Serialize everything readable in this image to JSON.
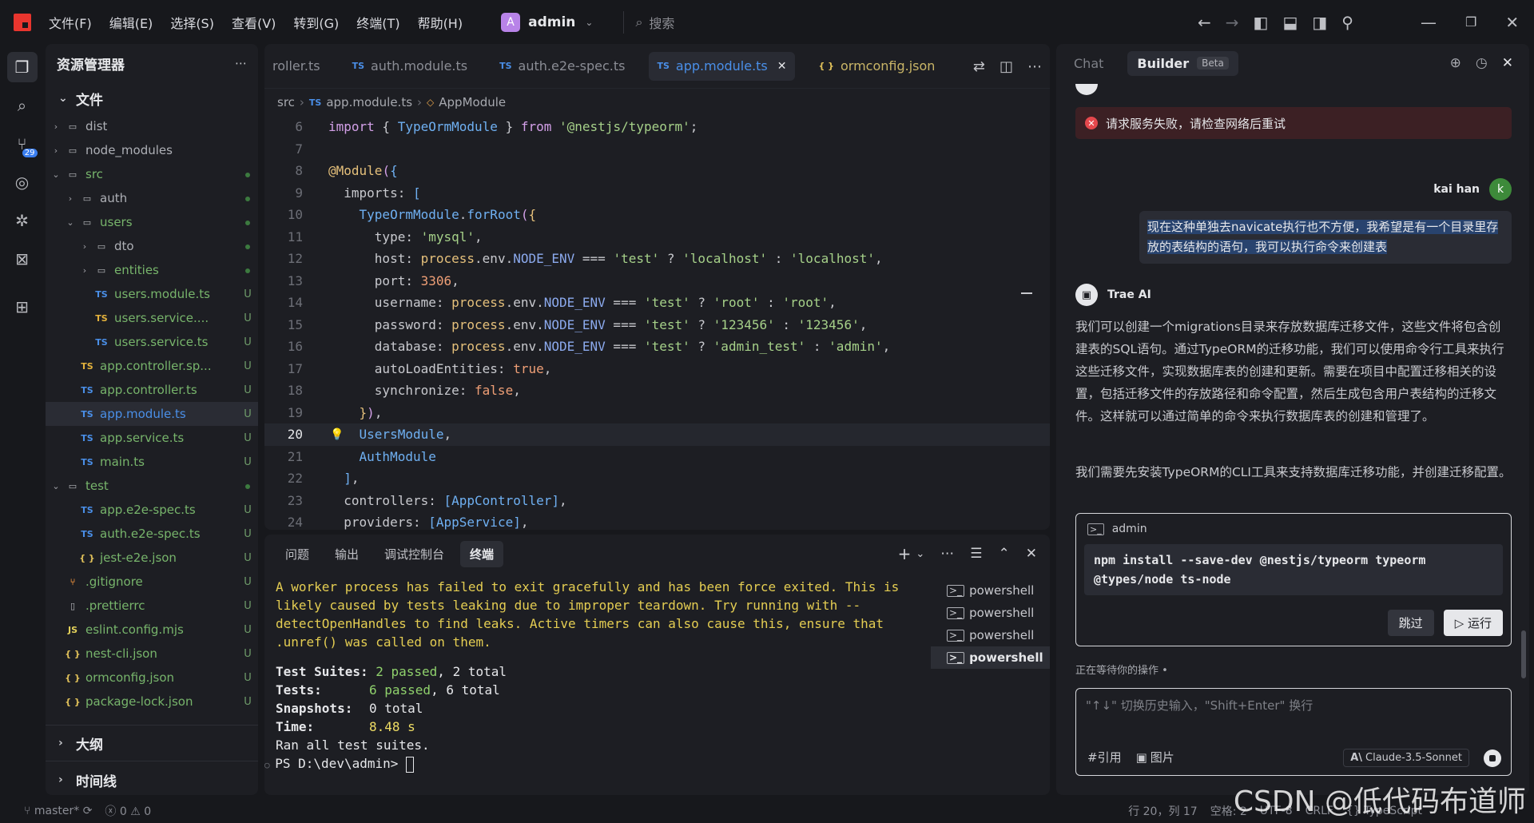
{
  "titlebar": {
    "menu": [
      "文件(F)",
      "编辑(E)",
      "选择(S)",
      "查看(V)",
      "转到(G)",
      "终端(T)",
      "帮助(H)"
    ],
    "workspace_initial": "A",
    "workspace_name": "admin",
    "search_placeholder": "搜索"
  },
  "explorer": {
    "title": "资源管理器",
    "section_files": "文件",
    "items": [
      {
        "name": "dist",
        "kind": "folder",
        "depth": 0,
        "expanded": false,
        "status": ""
      },
      {
        "name": "node_modules",
        "kind": "folder",
        "depth": 0,
        "expanded": false,
        "status": ""
      },
      {
        "name": "src",
        "kind": "folder",
        "depth": 0,
        "expanded": true,
        "status": "dot",
        "color": "green"
      },
      {
        "name": "auth",
        "kind": "folder",
        "depth": 1,
        "expanded": false,
        "status": "dot"
      },
      {
        "name": "users",
        "kind": "folder",
        "depth": 1,
        "expanded": true,
        "status": "dot",
        "color": "green"
      },
      {
        "name": "dto",
        "kind": "folder",
        "depth": 2,
        "expanded": false,
        "status": "dot"
      },
      {
        "name": "entities",
        "kind": "folder",
        "depth": 2,
        "expanded": false,
        "status": "dot",
        "color": "green"
      },
      {
        "name": "users.module.ts",
        "kind": "ts",
        "depth": 2,
        "status": "U",
        "color": "green"
      },
      {
        "name": "users.service....",
        "kind": "ts-yellow",
        "depth": 2,
        "status": "U",
        "color": "green"
      },
      {
        "name": "users.service.ts",
        "kind": "ts",
        "depth": 2,
        "status": "U",
        "color": "green"
      },
      {
        "name": "app.controller.sp...",
        "kind": "ts-yellow",
        "depth": 1,
        "status": "U",
        "color": "green"
      },
      {
        "name": "app.controller.ts",
        "kind": "ts",
        "depth": 1,
        "status": "U",
        "color": "green"
      },
      {
        "name": "app.module.ts",
        "kind": "ts",
        "depth": 1,
        "status": "U",
        "color": "blue",
        "selected": true
      },
      {
        "name": "app.service.ts",
        "kind": "ts",
        "depth": 1,
        "status": "U",
        "color": "green"
      },
      {
        "name": "main.ts",
        "kind": "ts",
        "depth": 1,
        "status": "U",
        "color": "green"
      },
      {
        "name": "test",
        "kind": "folder",
        "depth": 0,
        "expanded": true,
        "status": "dot",
        "color": "green"
      },
      {
        "name": "app.e2e-spec.ts",
        "kind": "ts",
        "depth": 1,
        "status": "U",
        "color": "green"
      },
      {
        "name": "auth.e2e-spec.ts",
        "kind": "ts",
        "depth": 1,
        "status": "U",
        "color": "green"
      },
      {
        "name": "jest-e2e.json",
        "kind": "json",
        "depth": 1,
        "status": "U",
        "color": "green"
      },
      {
        "name": ".gitignore",
        "kind": "git",
        "depth": 0,
        "status": "U",
        "color": "green"
      },
      {
        "name": ".prettierrc",
        "kind": "file",
        "depth": 0,
        "status": "U",
        "color": "green"
      },
      {
        "name": "eslint.config.mjs",
        "kind": "js",
        "depth": 0,
        "status": "U",
        "color": "green"
      },
      {
        "name": "nest-cli.json",
        "kind": "json",
        "depth": 0,
        "status": "U",
        "color": "green"
      },
      {
        "name": "ormconfig.json",
        "kind": "json",
        "depth": 0,
        "status": "U",
        "color": "green"
      },
      {
        "name": "package-lock.json",
        "kind": "json",
        "depth": 0,
        "status": "U",
        "color": "green"
      }
    ],
    "section_outline": "大纲",
    "section_timeline": "时间线"
  },
  "editor": {
    "tabs": [
      {
        "label": "roller.ts",
        "icon": "",
        "active": false
      },
      {
        "label": "auth.module.ts",
        "icon": "TS",
        "active": false
      },
      {
        "label": "auth.e2e-spec.ts",
        "icon": "TS",
        "active": false
      },
      {
        "label": "app.module.ts",
        "icon": "TS",
        "active": true
      },
      {
        "label": "ormconfig.json",
        "icon": "{ }",
        "active": false
      }
    ],
    "breadcrumb": {
      "folder": "src",
      "file_icon": "TS",
      "file": "app.module.ts",
      "symbol": "AppModule"
    },
    "current_line": 20,
    "lines": [
      {
        "n": 6,
        "tokens": [
          [
            "kw",
            "import"
          ],
          [
            "p",
            " { "
          ],
          [
            "fn",
            "TypeOrmModule"
          ],
          [
            "p",
            " } "
          ],
          [
            "kw",
            "from"
          ],
          [
            "p",
            " "
          ],
          [
            "str",
            "'@nestjs/typeorm'"
          ],
          [
            "p",
            ";"
          ]
        ]
      },
      {
        "n": 7,
        "tokens": []
      },
      {
        "n": 8,
        "tokens": [
          [
            "dec",
            "@Module"
          ],
          [
            "brk",
            "("
          ],
          [
            "brk2",
            "{"
          ]
        ]
      },
      {
        "n": 9,
        "tokens": [
          [
            "p",
            "  imports: "
          ],
          [
            "brk2",
            "["
          ]
        ]
      },
      {
        "n": 10,
        "tokens": [
          [
            "p",
            "    "
          ],
          [
            "fn",
            "TypeOrmModule"
          ],
          [
            "p",
            "."
          ],
          [
            "fn",
            "forRoot"
          ],
          [
            "brk",
            "("
          ],
          [
            "dec",
            "{"
          ]
        ]
      },
      {
        "n": 11,
        "tokens": [
          [
            "p",
            "      type: "
          ],
          [
            "str",
            "'mysql'"
          ],
          [
            "p",
            ","
          ]
        ]
      },
      {
        "n": 12,
        "tokens": [
          [
            "p",
            "      host: "
          ],
          [
            "dec",
            "process"
          ],
          [
            "p",
            "."
          ],
          [
            "p",
            "env"
          ],
          [
            "p",
            "."
          ],
          [
            "var",
            "NODE_ENV"
          ],
          [
            "p",
            " === "
          ],
          [
            "str",
            "'test'"
          ],
          [
            "p",
            " ? "
          ],
          [
            "str",
            "'localhost'"
          ],
          [
            "p",
            " : "
          ],
          [
            "str",
            "'localhost'"
          ],
          [
            "p",
            ","
          ]
        ]
      },
      {
        "n": 13,
        "tokens": [
          [
            "p",
            "      port: "
          ],
          [
            "num",
            "3306"
          ],
          [
            "p",
            ","
          ]
        ]
      },
      {
        "n": 14,
        "tokens": [
          [
            "p",
            "      username: "
          ],
          [
            "dec",
            "process"
          ],
          [
            "p",
            ".env."
          ],
          [
            "var",
            "NODE_ENV"
          ],
          [
            "p",
            " === "
          ],
          [
            "str",
            "'test'"
          ],
          [
            "p",
            " ? "
          ],
          [
            "str",
            "'root'"
          ],
          [
            "p",
            " : "
          ],
          [
            "str",
            "'root'"
          ],
          [
            "p",
            ","
          ]
        ]
      },
      {
        "n": 15,
        "tokens": [
          [
            "p",
            "      password: "
          ],
          [
            "dec",
            "process"
          ],
          [
            "p",
            ".env."
          ],
          [
            "var",
            "NODE_ENV"
          ],
          [
            "p",
            " === "
          ],
          [
            "str",
            "'test'"
          ],
          [
            "p",
            " ? "
          ],
          [
            "str",
            "'123456'"
          ],
          [
            "p",
            " : "
          ],
          [
            "str",
            "'123456'"
          ],
          [
            "p",
            ","
          ]
        ]
      },
      {
        "n": 16,
        "tokens": [
          [
            "p",
            "      database: "
          ],
          [
            "dec",
            "process"
          ],
          [
            "p",
            ".env."
          ],
          [
            "var",
            "NODE_ENV"
          ],
          [
            "p",
            " === "
          ],
          [
            "str",
            "'test'"
          ],
          [
            "p",
            " ? "
          ],
          [
            "str",
            "'admin_test'"
          ],
          [
            "p",
            " : "
          ],
          [
            "str",
            "'admin'"
          ],
          [
            "p",
            ","
          ]
        ]
      },
      {
        "n": 17,
        "tokens": [
          [
            "p",
            "      autoLoadEntities: "
          ],
          [
            "bool",
            "true"
          ],
          [
            "p",
            ","
          ]
        ]
      },
      {
        "n": 18,
        "tokens": [
          [
            "p",
            "      synchronize: "
          ],
          [
            "bool",
            "false"
          ],
          [
            "p",
            ","
          ]
        ]
      },
      {
        "n": 19,
        "tokens": [
          [
            "p",
            "    "
          ],
          [
            "dec",
            "}"
          ],
          [
            "brk",
            ")"
          ],
          [
            "p",
            ","
          ]
        ]
      },
      {
        "n": 20,
        "tokens": [
          [
            "p",
            "    "
          ],
          [
            "fn",
            "UsersModule"
          ],
          [
            "p",
            ","
          ]
        ]
      },
      {
        "n": 21,
        "tokens": [
          [
            "p",
            "    "
          ],
          [
            "fn",
            "AuthModule"
          ]
        ]
      },
      {
        "n": 22,
        "tokens": [
          [
            "p",
            "  "
          ],
          [
            "brk2",
            "]"
          ],
          [
            "p",
            ","
          ]
        ]
      },
      {
        "n": 23,
        "tokens": [
          [
            "p",
            "  controllers: "
          ],
          [
            "brk2",
            "["
          ],
          [
            "fn",
            "AppController"
          ],
          [
            "brk2",
            "]"
          ],
          [
            "p",
            ","
          ]
        ]
      },
      {
        "n": 24,
        "tokens": [
          [
            "p",
            "  providers: "
          ],
          [
            "brk2",
            "["
          ],
          [
            "fn",
            "AppService"
          ],
          [
            "brk2",
            "]"
          ],
          [
            "p",
            ","
          ]
        ]
      }
    ]
  },
  "panel": {
    "tabs": [
      "问题",
      "输出",
      "调试控制台",
      "终端"
    ],
    "active_tab": "终端",
    "terminal": {
      "warning": "A worker process has failed to exit gracefully and has been force exited. This is likely caused by tests leaking due to improper teardown. Try running with --detectOpenHandles to find leaks. Active timers can also cause this, ensure that .unref() was called on them.",
      "suites_label": "Test Suites:",
      "suites_passed": "2 passed",
      "suites_total": ", 2 total",
      "tests_label": "Tests:",
      "tests_passed": "6 passed",
      "tests_total": ", 6 total",
      "snap_label": "Snapshots:",
      "snap_value": "0 total",
      "time_label": "Time:",
      "time_value": "8.48 s",
      "ran": "Ran all test suites.",
      "prompt": "PS D:\\dev\\admin> "
    },
    "terminals": [
      "powershell",
      "powershell",
      "powershell",
      "powershell"
    ]
  },
  "chat": {
    "tabs": {
      "chat": "Chat",
      "builder": "Builder",
      "beta": "Beta"
    },
    "error": "请求服务失败，请检查网络后重试",
    "user": {
      "name": "kai han",
      "initial": "k"
    },
    "user_message": "现在这种单独去navicate执行也不方便，我希望是有一个目录里存放的表结构的语句，我可以执行命令来创建表",
    "ai": {
      "name": "Trae AI"
    },
    "ai_para1": "我们可以创建一个migrations目录来存放数据库迁移文件，这些文件将包含创建表的SQL语句。通过TypeORM的迁移功能，我们可以使用命令行工具来执行这些迁移文件，实现数据库表的创建和更新。需要在项目中配置迁移相关的设置，包括迁移文件的存放路径和命令配置，然后生成包含用户表结构的迁移文件。这样就可以通过简单的命令来执行数据库表的创建和管理了。",
    "ai_para2": "我们需要先安装TypeORM的CLI工具来支持数据库迁移功能，并创建迁移配置。",
    "command_card": {
      "cwd": "admin",
      "command": "npm install --save-dev @nestjs/typeorm typeorm @types/node ts-node",
      "skip": "跳过",
      "run": "▷ 运行"
    },
    "waiting": "正在等待你的操作 •",
    "input_placeholder": "\"↑↓\" 切换历史输入，\"Shift+Enter\" 换行",
    "tool_ref": "#引用",
    "tool_image": "图片",
    "model": "Claude-3.5-Sonnet"
  },
  "statusbar": {
    "branch": "master*",
    "errors": "0",
    "warnings": "0",
    "position": "行 20，列 17",
    "spaces": "空格: 2",
    "encoding": "UTF-8",
    "eol": "CRLF",
    "language": "TypeScript"
  },
  "watermark": "CSDN @低代码布道师"
}
